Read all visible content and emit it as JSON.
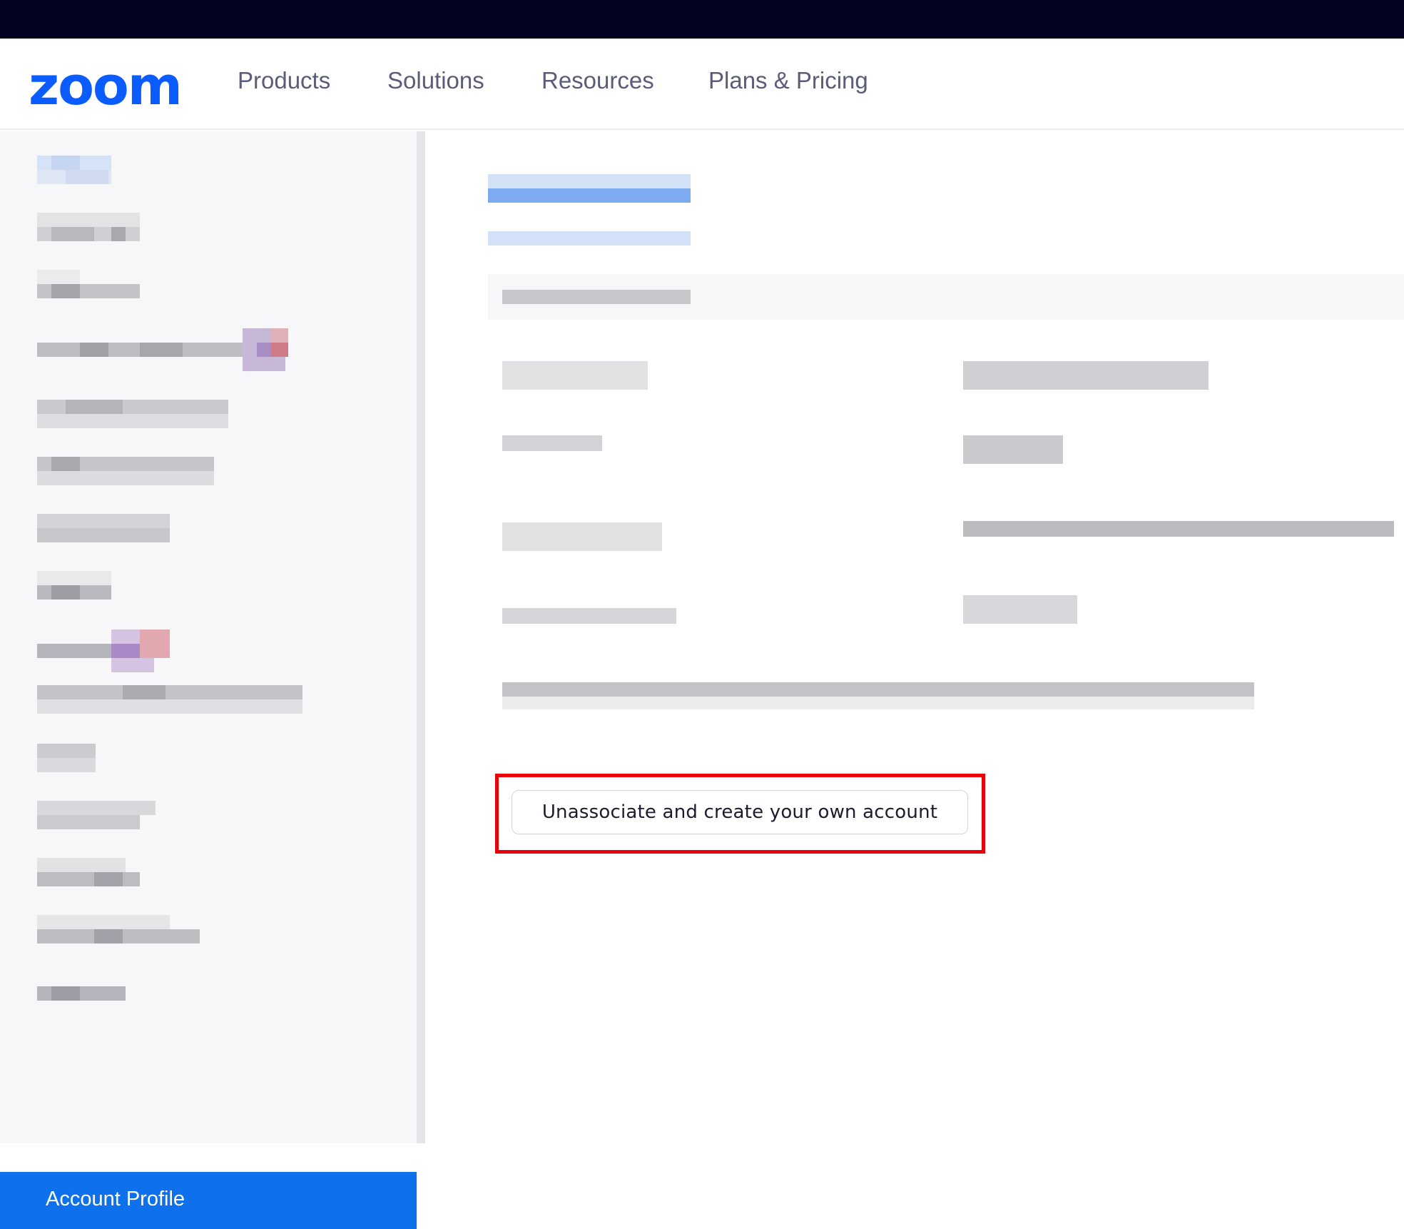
{
  "header": {
    "logo": "zoom",
    "nav": [
      {
        "label": "Products"
      },
      {
        "label": "Solutions"
      },
      {
        "label": "Resources"
      },
      {
        "label": "Plans & Pricing"
      }
    ]
  },
  "sidebar": {
    "active_item": "Account Profile"
  },
  "main": {
    "unassociate_button": "Unassociate and create your own account"
  },
  "colors": {
    "topbar": "#020421",
    "brand": "#0b5cff",
    "nav_text": "#5a5c7a",
    "sidebar_bg": "#f7f7f9",
    "active_item_bg": "#0e71eb",
    "highlight": "#e8000b"
  }
}
